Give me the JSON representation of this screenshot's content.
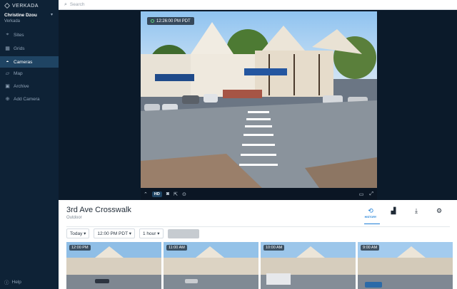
{
  "brand": "VERKADA",
  "user": {
    "name": "Christine Dzou",
    "org": "Verkada"
  },
  "nav": [
    {
      "label": "Sites",
      "icon": "map-pin-icon"
    },
    {
      "label": "Grids",
      "icon": "grid-icon"
    },
    {
      "label": "Cameras",
      "icon": "camera-icon",
      "active": true
    },
    {
      "label": "Map",
      "icon": "map-icon"
    },
    {
      "label": "Archive",
      "icon": "archive-icon"
    },
    {
      "label": "Add Camera",
      "icon": "plus-icon"
    }
  ],
  "help": "Help",
  "search": {
    "placeholder": "Search"
  },
  "video": {
    "timestamp": "12:26:00 PM PDT",
    "quality": "HD"
  },
  "camera": {
    "name": "3rd Ave Crosswalk",
    "location": "Outdoor"
  },
  "actions": {
    "history": "HISTORY"
  },
  "filters": {
    "day": "Today ▾",
    "time": "12:00 PM PDT ▾",
    "range": "1 hour ▾",
    "extra": "XXXXXXXX"
  },
  "thumbnails": [
    {
      "time": "12:00 PM"
    },
    {
      "time": "11:00 AM"
    },
    {
      "time": "10:00 AM"
    },
    {
      "time": "9:00 AM"
    }
  ],
  "colors": {
    "sidebar": "#0e2236",
    "accent": "#1c7ed6",
    "active_nav": "#1f4463"
  }
}
